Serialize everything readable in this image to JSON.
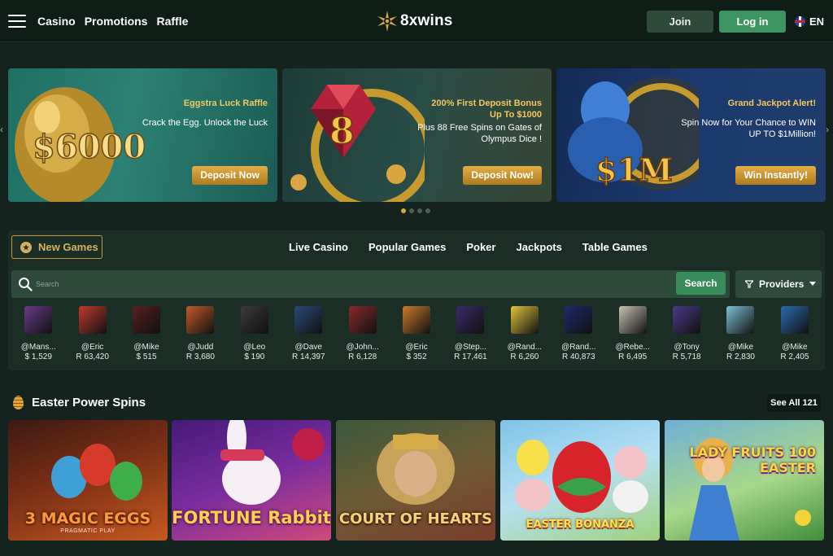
{
  "header": {
    "nav": [
      "Casino",
      "Promotions",
      "Raffle"
    ],
    "logo_text": "8xwins",
    "join_label": "Join",
    "login_label": "Log in",
    "language": "EN"
  },
  "banners": [
    {
      "art_text": "$6000",
      "subtitle": "Eggstra Luck Raffle",
      "description": "Crack the Egg. Unlock the Luck",
      "button": "Deposit Now",
      "background": "#2c8174"
    },
    {
      "art_text": "8",
      "subtitle": "200% First Deposit Bonus Up To $1000",
      "description": "Plus 88 Free Spins on Gates of Olympus Dice !",
      "button": "Deposit Now!",
      "background": "#2a4d47"
    },
    {
      "art_text": "$1M",
      "subtitle": "Grand Jackpot Alert!",
      "description": "Spin Now for Your Chance to WIN UP TO $1Million!",
      "button": "Win Instantly!",
      "background": "#1c3a6e"
    }
  ],
  "carousel": {
    "slides": 4,
    "active": 1
  },
  "games": {
    "new_games_label": "New Games",
    "categories": [
      "Live Casino",
      "Popular Games",
      "Poker",
      "Jackpots",
      "Table Games"
    ],
    "search_placeholder": "Search",
    "search_button": "Search",
    "providers_label": "Providers"
  },
  "winners": [
    {
      "name": "@Mans...",
      "amount": "$ 1,529",
      "thumb": "#6a3a8a"
    },
    {
      "name": "@Eric",
      "amount": "R 63,420",
      "thumb": "#c0392b"
    },
    {
      "name": "@Mike",
      "amount": "$ 515",
      "thumb": "#5a1f1f"
    },
    {
      "name": "@Judd",
      "amount": "R 3,680",
      "thumb": "#c25a2a"
    },
    {
      "name": "@Leo",
      "amount": "$ 190",
      "thumb": "#3a3a3a"
    },
    {
      "name": "@Dave",
      "amount": "R 14,397",
      "thumb": "#2a4a7a"
    },
    {
      "name": "@John...",
      "amount": "R 6,128",
      "thumb": "#8a2a2a"
    },
    {
      "name": "@Eric",
      "amount": "$ 352",
      "thumb": "#c97a2a"
    },
    {
      "name": "@Step...",
      "amount": "R 17,461",
      "thumb": "#3a2a6a"
    },
    {
      "name": "@Rand...",
      "amount": "R 6,260",
      "thumb": "#e0c23a"
    },
    {
      "name": "@Rand...",
      "amount": "R 40,873",
      "thumb": "#1f2a6a"
    },
    {
      "name": "@Rebe...",
      "amount": "R 6,495",
      "thumb": "#c9c2b4"
    },
    {
      "name": "@Tony",
      "amount": "R 5,718",
      "thumb": "#4a3a8a"
    },
    {
      "name": "@Mike",
      "amount": "R 2,830",
      "thumb": "#7ac0d8"
    },
    {
      "name": "@Mike",
      "amount": "R 2,405",
      "thumb": "#2a6ab0"
    }
  ],
  "section": {
    "title": "Easter Power Spins",
    "see_all": "See All 121"
  },
  "tiles": [
    {
      "title": "3 MAGIC EGGS",
      "subtitle": "PRAGMATIC PLAY"
    },
    {
      "title": "FORTUNE Rabbit",
      "subtitle": ""
    },
    {
      "title": "COURT OF HEARTS",
      "subtitle": ""
    },
    {
      "title": "EASTER BONANZA",
      "subtitle": ""
    },
    {
      "title": "LADY FRUITS 100 EASTER",
      "subtitle": ""
    }
  ]
}
